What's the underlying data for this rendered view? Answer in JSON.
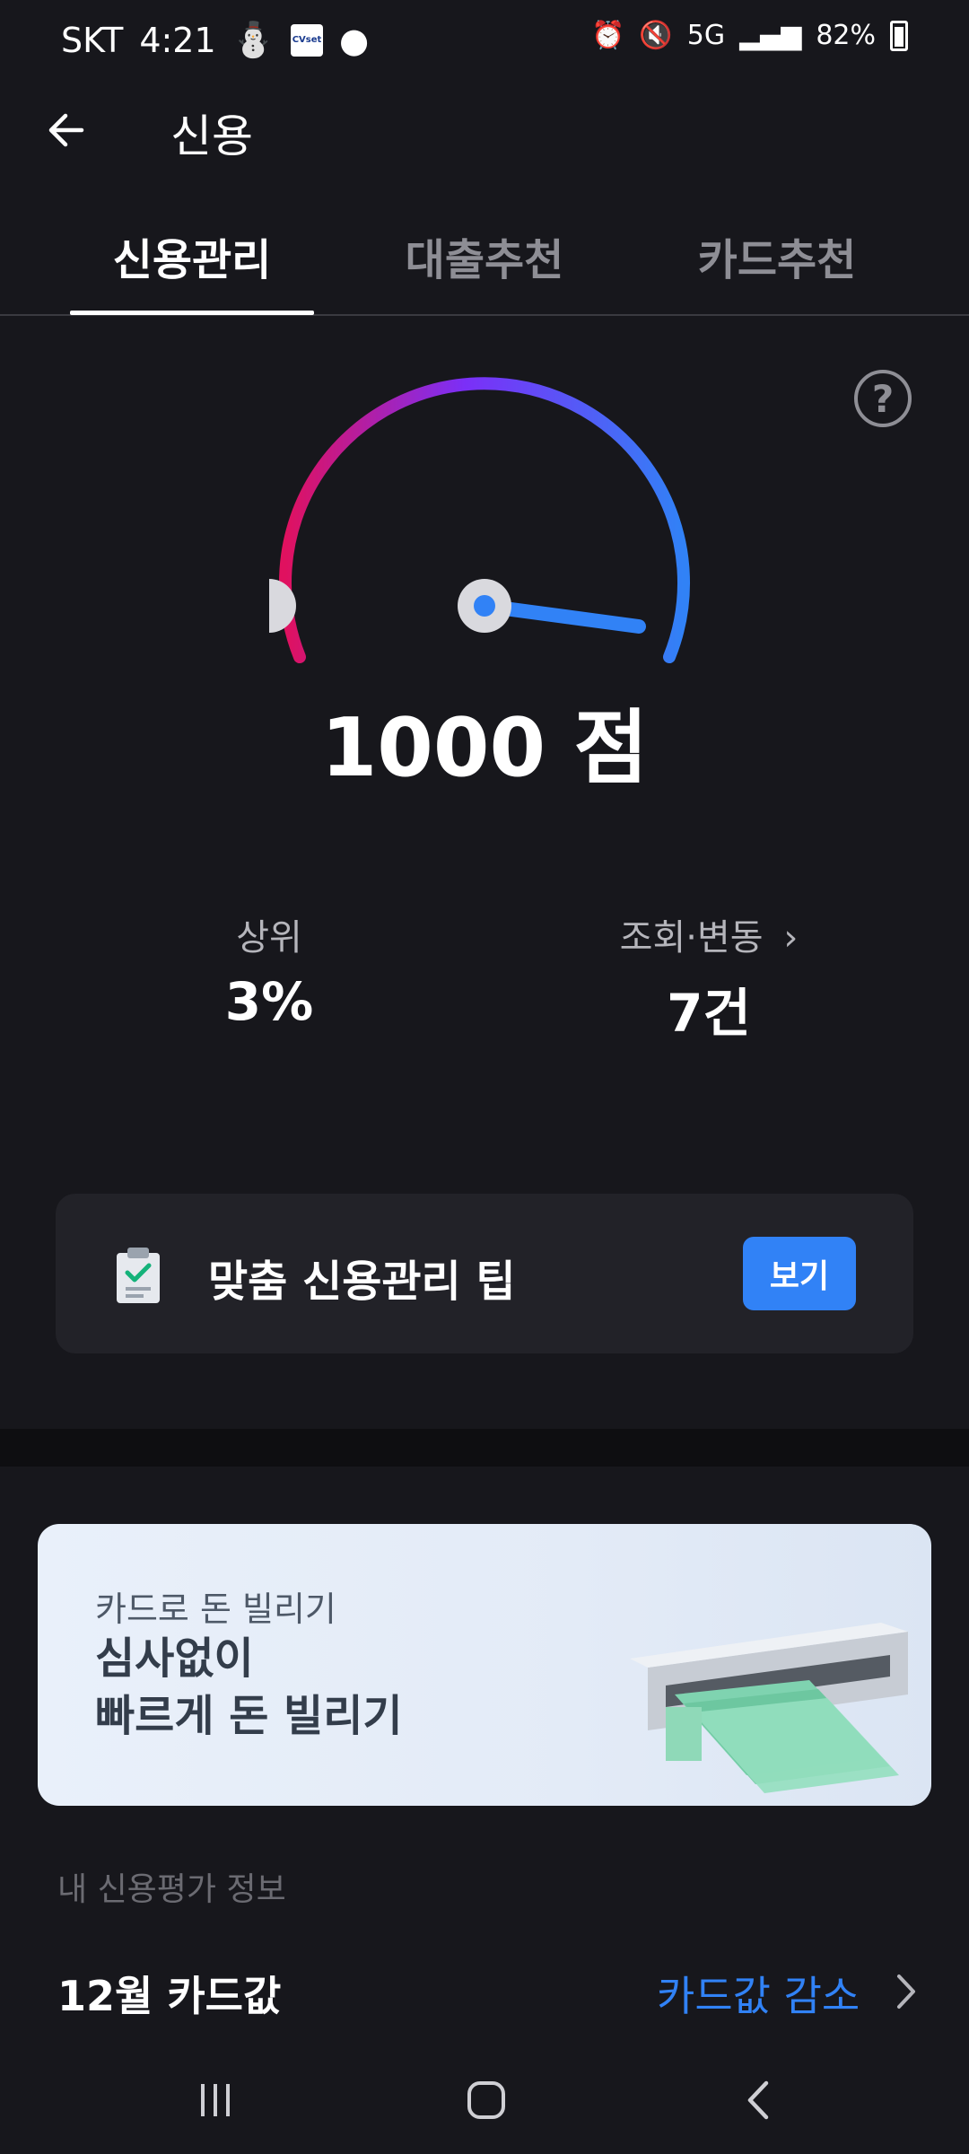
{
  "status_bar": {
    "carrier": "SKT",
    "time": "4:21",
    "app_badge": "CVset",
    "network": "5G",
    "battery": "82%"
  },
  "header": {
    "back_icon": "arrow-left-icon",
    "title": "신용"
  },
  "tabs": [
    {
      "label": "신용관리",
      "active": true
    },
    {
      "label": "대출추천",
      "active": false
    },
    {
      "label": "카드추천",
      "active": false
    }
  ],
  "gauge": {
    "help_icon": "question-circle-icon",
    "score_text": "1000 점",
    "level": 1.0,
    "colors": {
      "start": "#e0115f",
      "mid": "#7b2ff7",
      "end": "#3182f6",
      "needle": "#3182f6"
    }
  },
  "stats": {
    "rank": {
      "label": "상위",
      "value": "3%"
    },
    "inquiry": {
      "label": "조회·변동",
      "value": "7건"
    }
  },
  "tip": {
    "icon": "clipboard-check-icon",
    "text": "맞춤 신용관리 팁",
    "button": "보기"
  },
  "banner": {
    "subtitle": "카드로 돈 빌리기",
    "title_line1": "심사없이",
    "title_line2": "빠르게 돈 빌리기",
    "art": "money-atm-icon"
  },
  "credit_info": {
    "section_label": "내 신용평가 정보",
    "card_title": "12월 카드값",
    "card_status": "카드값 감소"
  },
  "nav": {
    "recent": "recent-apps-icon",
    "home": "home-icon",
    "back": "back-icon"
  },
  "accent_color": "#3182f6"
}
